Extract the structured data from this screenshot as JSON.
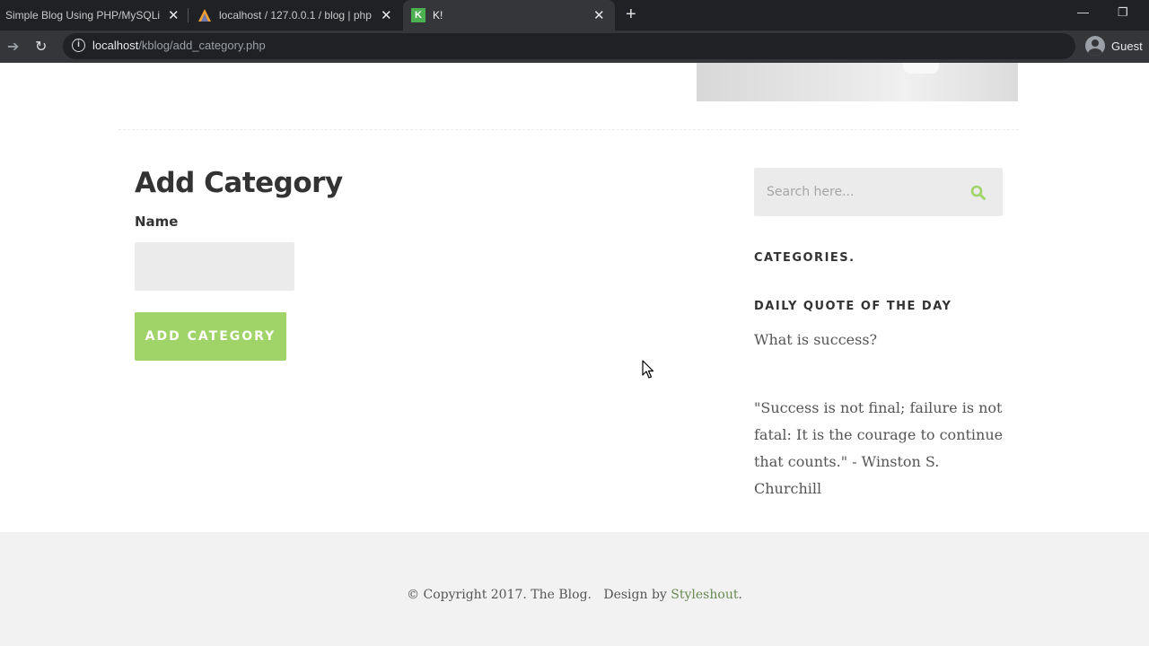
{
  "browser": {
    "tabs": [
      {
        "title": "Simple Blog Using PHP/MySQLi",
        "active": false
      },
      {
        "title": "localhost / 127.0.0.1 / blog | php",
        "active": false
      },
      {
        "title": "K!",
        "active": true
      }
    ],
    "favicon_letter": "K",
    "url_host": "localhost",
    "url_path": "/kblog/add_category.php",
    "profile_label": "Guest",
    "colors": {
      "tabbar": "#202124",
      "toolbar": "#35363a"
    }
  },
  "main": {
    "title": "Add Category",
    "name_label": "Name",
    "name_value": "",
    "submit_label": "ADD CATEGORY"
  },
  "sidebar": {
    "search_placeholder": "Search here...",
    "categories_heading": "CATEGORIES.",
    "quote_heading": "DAILY QUOTE OF THE DAY",
    "quote_question": "What is success?",
    "quote_text": "\"Success is not final; failure is not fatal: It is the courage to continue that counts.\" - Winston S. Churchill"
  },
  "footer": {
    "copyright": "© Copyright 2017. The Blog.",
    "design_by": "Design by",
    "designer": "Styleshout",
    "designer_suffix": "."
  },
  "colors": {
    "accent": "#a0d468",
    "footer_link": "#698a50",
    "footer_bg": "#f2f2f2"
  }
}
